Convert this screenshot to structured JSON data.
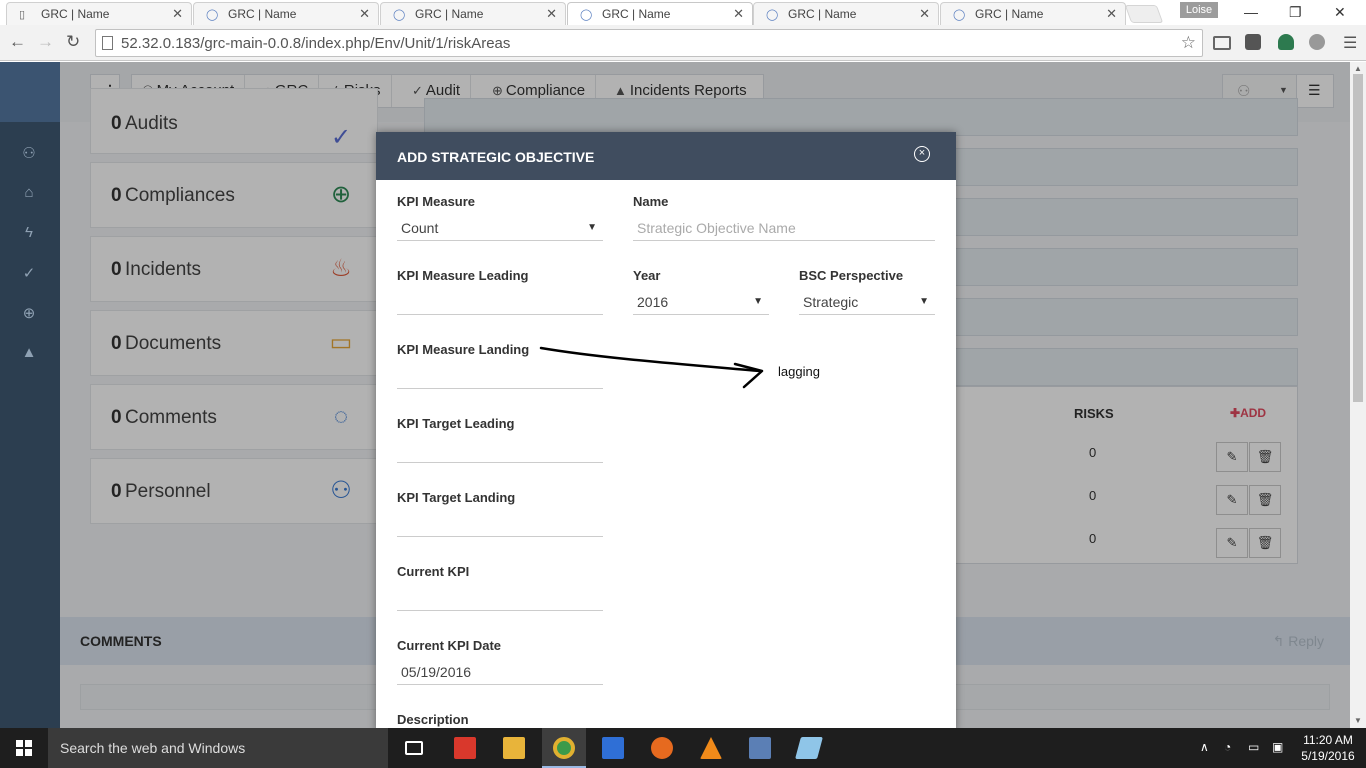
{
  "browser": {
    "tabs": [
      {
        "title": "GRC | Name",
        "icon": "document-icon"
      },
      {
        "title": "GRC | Name",
        "icon": "loading-icon"
      },
      {
        "title": "GRC | Name",
        "icon": "loading-icon"
      },
      {
        "title": "GRC | Name",
        "icon": "loading-icon",
        "active": true
      },
      {
        "title": "GRC | Name",
        "icon": "loading-icon"
      },
      {
        "title": "GRC | Name",
        "icon": "loading-icon"
      }
    ],
    "profile_name": "Loise",
    "url": "52.32.0.183/grc-main-0.0.8/index.php/Env/Unit/1/riskAreas"
  },
  "app": {
    "nav": [
      {
        "label": "My Account",
        "icon": "user-icon"
      },
      {
        "label": "GRC",
        "icon": "home-icon"
      },
      {
        "label": "Risks",
        "icon": "bolt-icon"
      },
      {
        "label": "Audit",
        "icon": "check-circle-icon"
      },
      {
        "label": "Compliance",
        "icon": "crosshair-icon"
      },
      {
        "label": "Incidents Reports",
        "icon": "warning-icon"
      }
    ],
    "stats": [
      {
        "count": "0",
        "label": "Audits",
        "icon": "check-circle-icon",
        "color": "#5b6fd6"
      },
      {
        "count": "0",
        "label": "Compliances",
        "icon": "crosshair-icon",
        "color": "#2e8b57"
      },
      {
        "count": "0",
        "label": "Incidents",
        "icon": "fire-icon",
        "color": "#e05a3a"
      },
      {
        "count": "0",
        "label": "Documents",
        "icon": "folder-icon",
        "color": "#e8a838"
      },
      {
        "count": "0",
        "label": "Comments",
        "icon": "comments-icon",
        "color": "#3a7bd5"
      },
      {
        "count": "0",
        "label": "Personnel",
        "icon": "people-icon",
        "color": "#3a7bd5"
      }
    ],
    "table": {
      "risks_header": "RISKS",
      "add_label": "ADD",
      "rows": [
        "0",
        "0",
        "0"
      ]
    },
    "comments_title": "COMMENTS",
    "reply_label": "Reply"
  },
  "modal": {
    "title": "ADD STRATEGIC OBJECTIVE",
    "fields": {
      "kpi_measure": {
        "label": "KPI Measure",
        "value": "Count"
      },
      "name": {
        "label": "Name",
        "placeholder": "Strategic Objective Name"
      },
      "kpi_measure_leading": {
        "label": "KPI Measure Leading",
        "value": ""
      },
      "year": {
        "label": "Year",
        "value": "2016"
      },
      "bsc_perspective": {
        "label": "BSC Perspective",
        "value": "Strategic"
      },
      "kpi_measure_landing": {
        "label": "KPI Measure Landing",
        "value": ""
      },
      "kpi_target_leading": {
        "label": "KPI Target Leading",
        "value": ""
      },
      "kpi_target_landing": {
        "label": "KPI Target Landing",
        "value": ""
      },
      "current_kpi": {
        "label": "Current KPI",
        "value": ""
      },
      "current_kpi_date": {
        "label": "Current KPI Date",
        "value": "05/19/2016"
      },
      "description": {
        "label": "Description"
      }
    }
  },
  "annotation": {
    "text": "lagging"
  },
  "taskbar": {
    "search_placeholder": "Search the web and Windows",
    "time": "11:20 AM",
    "date": "5/19/2016"
  }
}
